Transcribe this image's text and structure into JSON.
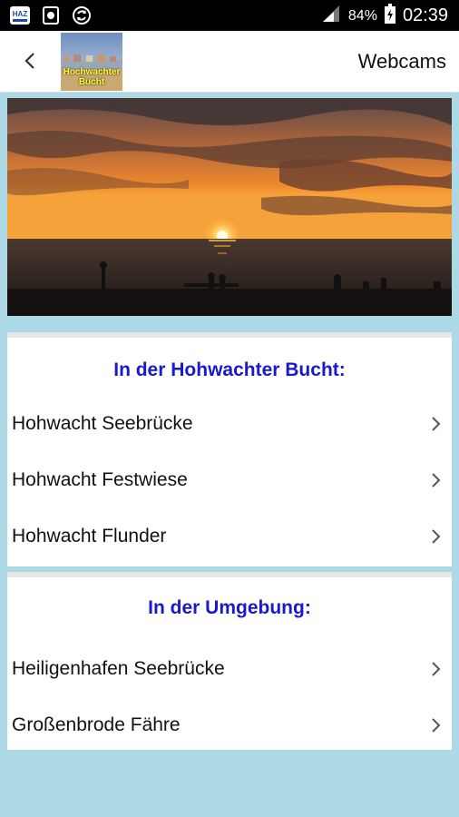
{
  "statusbar": {
    "battery": "84%",
    "time": "02:39",
    "icons": [
      "haz-app-icon",
      "screenshot-icon",
      "sync-icon",
      "signal-icon",
      "battery-charging-icon"
    ]
  },
  "appbar": {
    "title": "Webcams",
    "logo_text": "Hochwachter Bucht"
  },
  "sections": [
    {
      "title": "In der Hohwachter Bucht:",
      "items": [
        "Hohwacht Seebrücke",
        "Hohwacht Festwiese",
        "Hohwacht Flunder"
      ]
    },
    {
      "title": "In der Umgebung:",
      "items": [
        "Heiligenhafen Seebrücke",
        "Großenbrode Fähre"
      ]
    }
  ]
}
